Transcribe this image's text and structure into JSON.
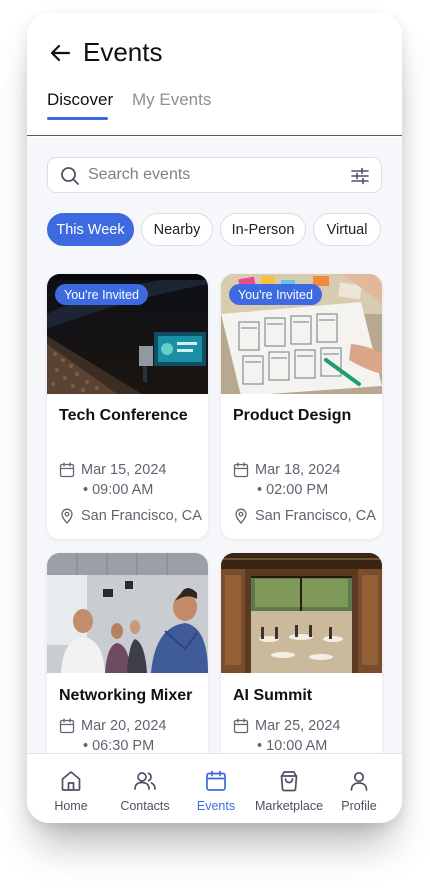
{
  "header": {
    "title": "Events",
    "tabs": [
      {
        "label": "Discover",
        "active": true
      },
      {
        "label": "My Events",
        "active": false
      }
    ]
  },
  "search": {
    "placeholder": "Search events",
    "value": ""
  },
  "filters": [
    {
      "label": "This Week",
      "active": true
    },
    {
      "label": "Nearby",
      "active": false
    },
    {
      "label": "In-Person",
      "active": false
    },
    {
      "label": "Virtual",
      "active": false
    }
  ],
  "events": [
    {
      "badge": "You're Invited",
      "title": "Tech Conference",
      "date": "Mar 15, 2024",
      "time": "• 09:00 AM",
      "location": "San Francisco, CA",
      "image": "conference-hall-photo"
    },
    {
      "badge": "You're Invited",
      "title": "Product Design",
      "date": "Mar 18, 2024",
      "time": "• 02:00 PM",
      "location": "San Francisco, CA",
      "image": "wireframe-sketches-photo"
    },
    {
      "title": "Networking Mixer",
      "date": "Mar 20, 2024",
      "time": "• 06:30 PM",
      "image": "people-networking-photo"
    },
    {
      "title": "AI Summit",
      "date": "Mar 25, 2024",
      "time": "• 10:00 AM",
      "image": "restaurant-venue-photo"
    }
  ],
  "nav": [
    {
      "label": "Home",
      "icon": "home-icon",
      "active": false
    },
    {
      "label": "Contacts",
      "icon": "contacts-icon",
      "active": false
    },
    {
      "label": "Events",
      "icon": "calendar-icon",
      "active": true
    },
    {
      "label": "Marketplace",
      "icon": "shopping-bag-icon",
      "active": false
    },
    {
      "label": "Profile",
      "icon": "profile-icon",
      "active": false
    }
  ],
  "colors": {
    "accent": "#3d6ae0",
    "background": "#f6f7fa",
    "muted_text": "#5f6570"
  }
}
